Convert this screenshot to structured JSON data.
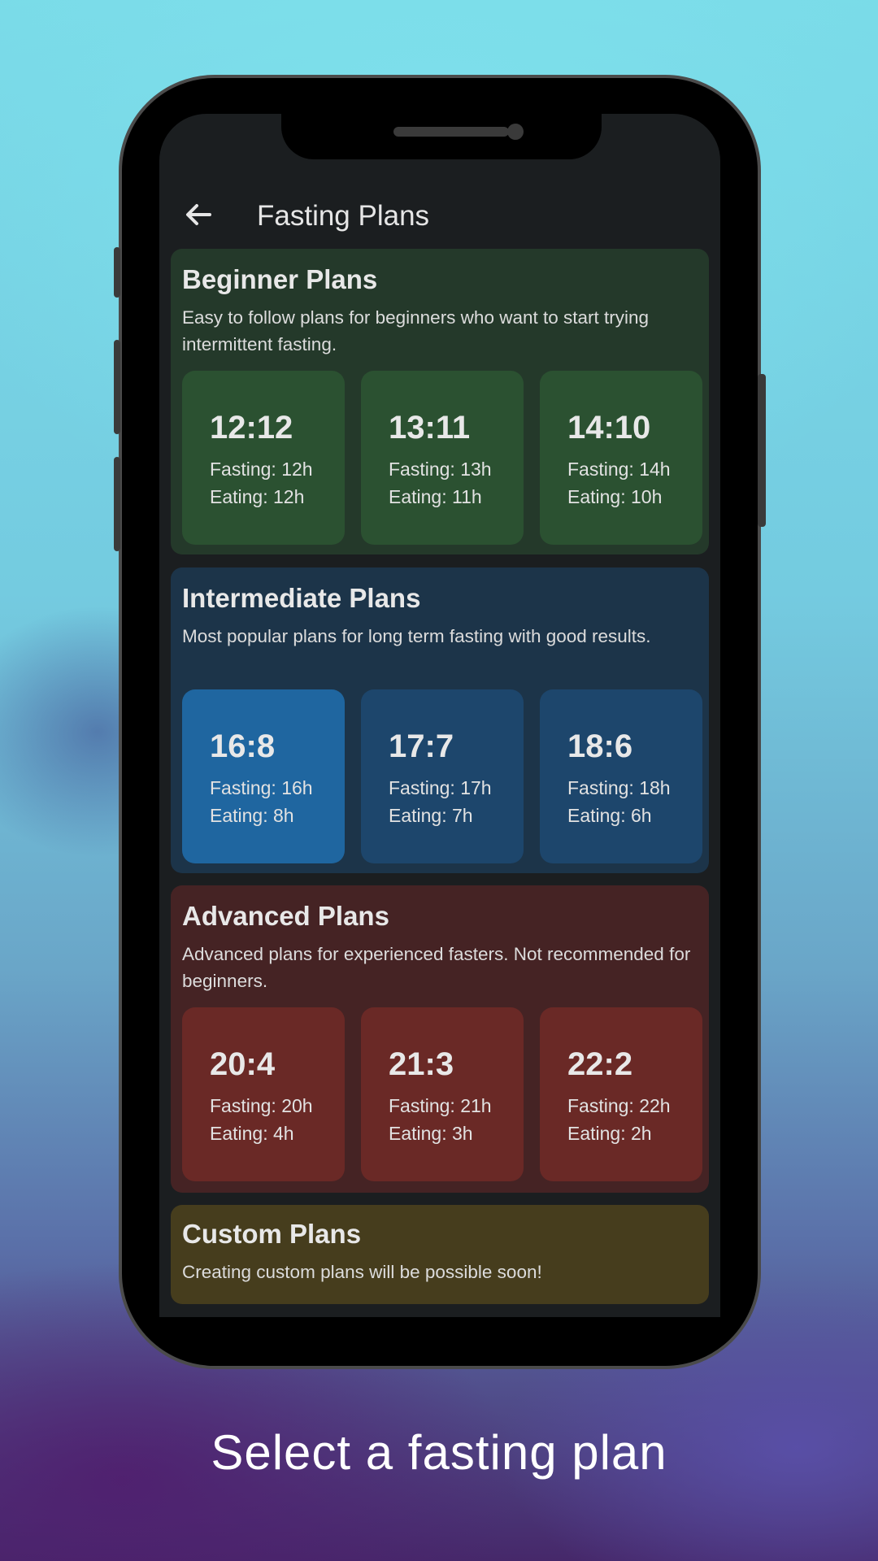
{
  "app_bar": {
    "title": "Fasting Plans",
    "back_icon": "arrow-left-icon"
  },
  "sections": {
    "beginner": {
      "title": "Beginner Plans",
      "description": "Easy to follow plans for beginners who want to start trying intermittent fasting.",
      "color": "#24392a",
      "plans": [
        {
          "ratio": "12:12",
          "fasting": "Fasting: 12h",
          "eating": "Eating: 12h"
        },
        {
          "ratio": "13:11",
          "fasting": "Fasting: 13h",
          "eating": "Eating: 11h"
        },
        {
          "ratio": "14:10",
          "fasting": "Fasting: 14h",
          "eating": "Eating: 10h"
        }
      ]
    },
    "intermediate": {
      "title": "Intermediate Plans",
      "description": "Most popular plans for long term fasting with good results.",
      "color": "#1c3449",
      "selected": "16:8",
      "plans": [
        {
          "ratio": "16:8",
          "fasting": "Fasting: 16h",
          "eating": "Eating: 8h"
        },
        {
          "ratio": "17:7",
          "fasting": "Fasting: 17h",
          "eating": "Eating: 7h"
        },
        {
          "ratio": "18:6",
          "fasting": "Fasting: 18h",
          "eating": "Eating: 6h"
        }
      ]
    },
    "advanced": {
      "title": "Advanced Plans",
      "description": "Advanced plans for experienced fasters. Not recommended for beginners.",
      "color": "#452324",
      "plans": [
        {
          "ratio": "20:4",
          "fasting": "Fasting: 20h",
          "eating": "Eating: 4h"
        },
        {
          "ratio": "21:3",
          "fasting": "Fasting: 21h",
          "eating": "Eating: 3h"
        },
        {
          "ratio": "22:2",
          "fasting": "Fasting: 22h",
          "eating": "Eating: 2h"
        }
      ]
    },
    "custom": {
      "title": "Custom Plans",
      "description": "Creating custom plans will be possible soon!",
      "color": "#463d1d"
    }
  },
  "caption": "Select a fasting plan"
}
